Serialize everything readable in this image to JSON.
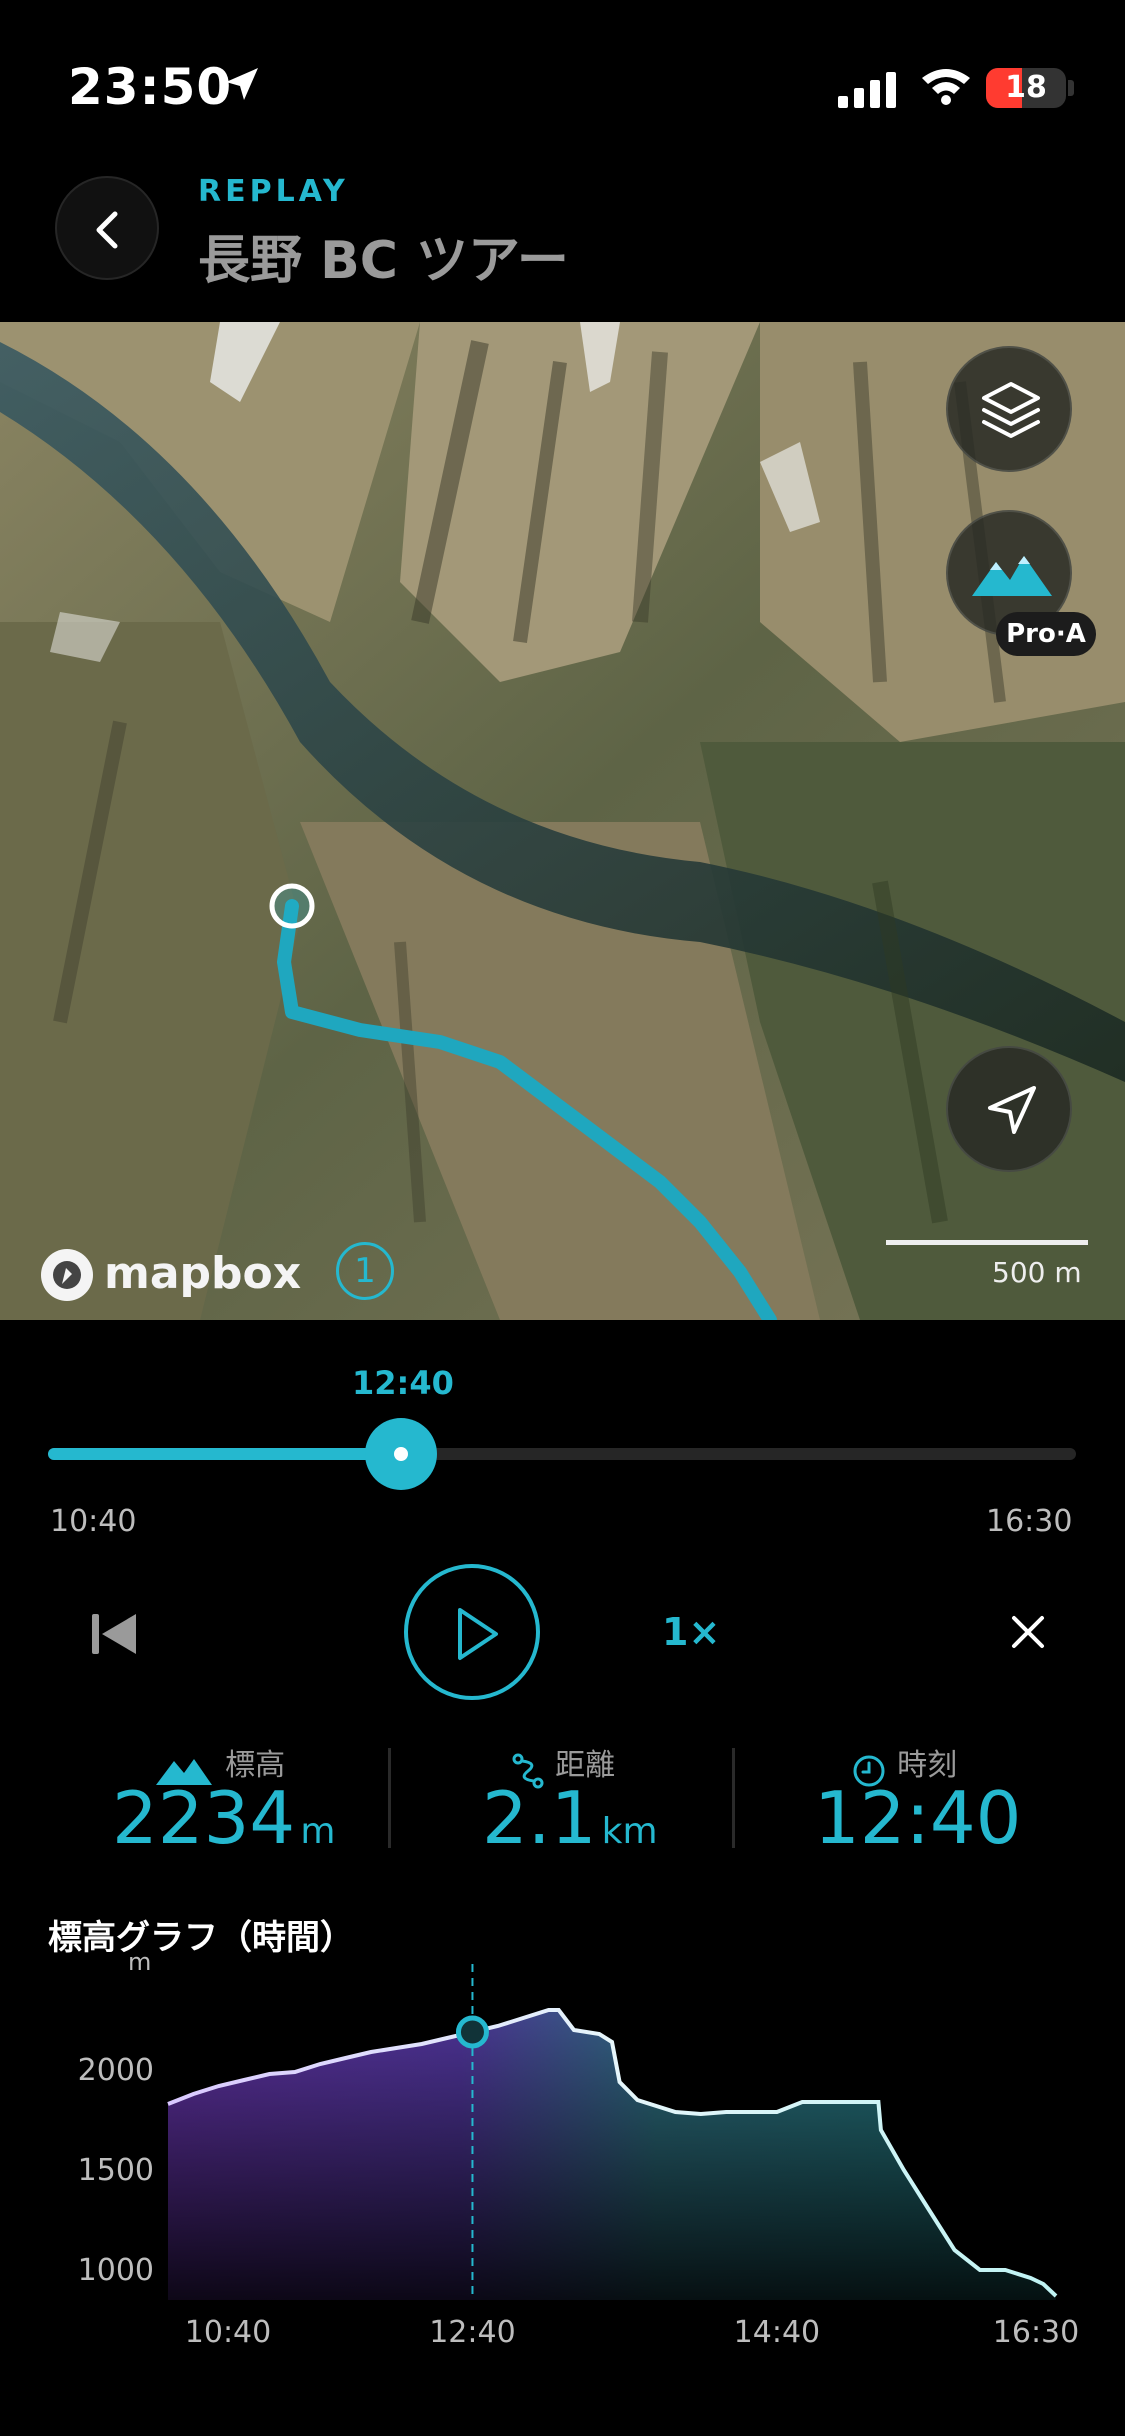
{
  "status_bar": {
    "time": "23:50",
    "battery": "18"
  },
  "header": {
    "subtitle": "REPLAY",
    "title": "長野 BC ツアー"
  },
  "map": {
    "attribution": "mapbox",
    "info_label": "1",
    "scale_label": "500 m",
    "terrain_badge": "Pro·A",
    "icons": [
      "layers-icon",
      "terrain-icon",
      "navigation-arrow-icon",
      "mapbox-logo-icon"
    ]
  },
  "timeline": {
    "current": "12:40",
    "start": "10:40",
    "end": "16:30",
    "progress": 0.343
  },
  "controls": {
    "speed": "1×"
  },
  "stats": {
    "elevation": {
      "label": "標高",
      "value": "2234",
      "unit": "m"
    },
    "distance": {
      "label": "距離",
      "value": "2.1",
      "unit": "km"
    },
    "time": {
      "label": "時刻",
      "value": "12:40"
    }
  },
  "graph": {
    "title": "標高グラフ（時間）",
    "unit": "m"
  },
  "colors": {
    "accent": "#25b8cf",
    "purple": "#6b3fa8",
    "teal": "#2a7e86"
  },
  "chart_data": {
    "type": "area",
    "xlabel": "",
    "ylabel": "m",
    "xticks": [
      "10:40",
      "12:40",
      "14:40",
      "16:30"
    ],
    "yticks": [
      2000,
      1500,
      1000
    ],
    "xlim": [
      "10:40",
      "16:30"
    ],
    "ylim": [
      850,
      2450
    ],
    "marker_x": "12:40",
    "x": [
      "10:40",
      "10:50",
      "11:00",
      "11:10",
      "11:20",
      "11:30",
      "11:40",
      "11:50",
      "12:00",
      "12:10",
      "12:20",
      "12:30",
      "12:40",
      "12:50",
      "13:00",
      "13:10",
      "13:14",
      "13:20",
      "13:30",
      "13:35",
      "13:38",
      "13:45",
      "13:55",
      "14:00",
      "14:10",
      "14:20",
      "14:30",
      "14:40",
      "14:50",
      "15:00",
      "15:10",
      "15:20",
      "15:21",
      "15:30",
      "15:40",
      "15:50",
      "16:00",
      "16:10",
      "16:20",
      "16:25",
      "16:30"
    ],
    "series": [
      {
        "values": [
          1830,
          1880,
          1920,
          1950,
          1980,
          1990,
          2030,
          2060,
          2090,
          2110,
          2130,
          2160,
          2190,
          2220,
          2260,
          2300,
          2300,
          2200,
          2180,
          2140,
          1940,
          1850,
          1810,
          1790,
          1780,
          1790,
          1790,
          1790,
          1840,
          1840,
          1840,
          1840,
          1700,
          1500,
          1300,
          1100,
          1000,
          1000,
          960,
          930,
          870
        ]
      }
    ]
  }
}
